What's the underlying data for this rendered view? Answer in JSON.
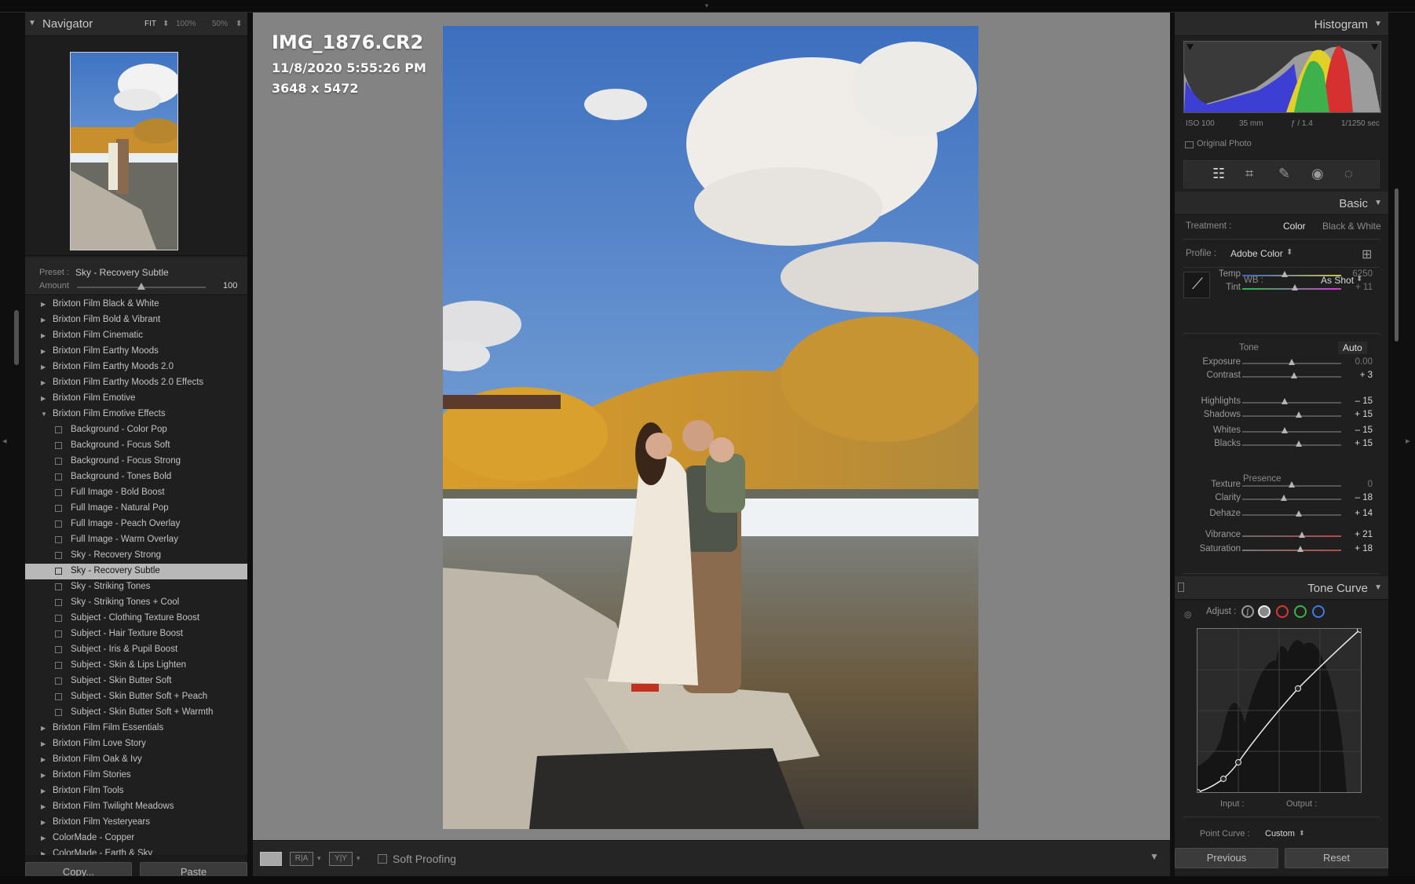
{
  "navigator": {
    "title": "Navigator",
    "zoom_options": [
      "FIT",
      "100%",
      "50%"
    ]
  },
  "preset": {
    "label": "Preset :",
    "value": "Sky - Recovery Subtle",
    "amount_label": "Amount",
    "amount_value": "100",
    "amount_fraction": 0.5
  },
  "preset_list": [
    {
      "label": "Brixton Film Black & White",
      "type": "group",
      "open": false
    },
    {
      "label": "Brixton Film Bold & Vibrant",
      "type": "group",
      "open": false
    },
    {
      "label": "Brixton Film Cinematic",
      "type": "group",
      "open": false
    },
    {
      "label": "Brixton Film Earthy Moods",
      "type": "group",
      "open": false
    },
    {
      "label": "Brixton Film Earthy Moods 2.0",
      "type": "group",
      "open": false
    },
    {
      "label": "Brixton Film Earthy Moods 2.0 Effects",
      "type": "group",
      "open": false
    },
    {
      "label": "Brixton Film Emotive",
      "type": "group",
      "open": false
    },
    {
      "label": "Brixton Film Emotive Effects",
      "type": "group",
      "open": true
    },
    {
      "label": "Background - Color Pop",
      "type": "preset"
    },
    {
      "label": "Background - Focus Soft",
      "type": "preset"
    },
    {
      "label": "Background - Focus Strong",
      "type": "preset"
    },
    {
      "label": "Background - Tones Bold",
      "type": "preset"
    },
    {
      "label": "Full Image - Bold Boost",
      "type": "preset"
    },
    {
      "label": "Full Image - Natural Pop",
      "type": "preset"
    },
    {
      "label": "Full Image - Peach Overlay",
      "type": "preset"
    },
    {
      "label": "Full Image - Warm Overlay",
      "type": "preset"
    },
    {
      "label": "Sky - Recovery Strong",
      "type": "preset"
    },
    {
      "label": "Sky - Recovery Subtle",
      "type": "preset",
      "selected": true
    },
    {
      "label": "Sky - Striking Tones",
      "type": "preset"
    },
    {
      "label": "Sky - Striking Tones + Cool",
      "type": "preset"
    },
    {
      "label": "Subject - Clothing Texture Boost",
      "type": "preset"
    },
    {
      "label": "Subject - Hair Texture Boost",
      "type": "preset"
    },
    {
      "label": "Subject - Iris & Pupil Boost",
      "type": "preset"
    },
    {
      "label": "Subject - Skin & Lips Lighten",
      "type": "preset"
    },
    {
      "label": "Subject - Skin Butter Soft",
      "type": "preset"
    },
    {
      "label": "Subject - Skin Butter Soft + Peach",
      "type": "preset"
    },
    {
      "label": "Subject - Skin Butter Soft + Warmth",
      "type": "preset"
    },
    {
      "label": "Brixton Film Film Essentials",
      "type": "group",
      "open": false
    },
    {
      "label": "Brixton Film Love Story",
      "type": "group",
      "open": false
    },
    {
      "label": "Brixton Film Oak & Ivy",
      "type": "group",
      "open": false
    },
    {
      "label": "Brixton Film Stories",
      "type": "group",
      "open": false
    },
    {
      "label": "Brixton Film Tools",
      "type": "group",
      "open": false
    },
    {
      "label": "Brixton Film Twilight Meadows",
      "type": "group",
      "open": false
    },
    {
      "label": "Brixton Film Yesteryears",
      "type": "group",
      "open": false
    },
    {
      "label": "ColorMade - Copper",
      "type": "group",
      "open": false
    },
    {
      "label": "ColorMade - Earth & Sky",
      "type": "group",
      "open": false
    }
  ],
  "left_buttons": {
    "copy": "Copy...",
    "paste": "Paste"
  },
  "image_info": {
    "filename": "IMG_1876.CR2",
    "datetime": "11/8/2020 5:55:26 PM",
    "dimensions": "3648 x 5472"
  },
  "toolbar": {
    "soft_proofing": "Soft Proofing"
  },
  "histogram": {
    "title": "Histogram",
    "iso": "ISO 100",
    "focal": "35 mm",
    "aperture": "ƒ / 1.4",
    "shutter": "1/1250 sec",
    "original_photo": "Original Photo"
  },
  "tools": [
    "sliders-icon",
    "crop-icon",
    "healing-icon",
    "redeye-icon",
    "mask-icon"
  ],
  "basic": {
    "title": "Basic",
    "treatment_label": "Treatment :",
    "treatment_color": "Color",
    "treatment_bw": "Black & White",
    "profile_label": "Profile :",
    "profile_value": "Adobe Color",
    "wb_label": "WB :",
    "wb_value": "As Shot",
    "tone_label": "Tone",
    "auto_label": "Auto",
    "presence_label": "Presence"
  },
  "sliders": {
    "temp": {
      "label": "Temp",
      "value": "6250",
      "pos": 0.43,
      "dim": true
    },
    "tint": {
      "label": "Tint",
      "value": "+ 11",
      "pos": 0.53,
      "dim": true
    },
    "exposure": {
      "label": "Exposure",
      "value": "0.00",
      "pos": 0.5,
      "dim": true
    },
    "contrast": {
      "label": "Contrast",
      "value": "+ 3",
      "pos": 0.52
    },
    "highlights": {
      "label": "Highlights",
      "value": "– 15",
      "pos": 0.43
    },
    "shadows": {
      "label": "Shadows",
      "value": "+ 15",
      "pos": 0.57
    },
    "whites": {
      "label": "Whites",
      "value": "– 15",
      "pos": 0.43
    },
    "blacks": {
      "label": "Blacks",
      "value": "+ 15",
      "pos": 0.57
    },
    "texture": {
      "label": "Texture",
      "value": "0",
      "pos": 0.5,
      "dim": true
    },
    "clarity": {
      "label": "Clarity",
      "value": "– 18",
      "pos": 0.42
    },
    "dehaze": {
      "label": "Dehaze",
      "value": "+ 14",
      "pos": 0.57
    },
    "vibrance": {
      "label": "Vibrance",
      "value": "+ 21",
      "pos": 0.6
    },
    "saturation": {
      "label": "Saturation",
      "value": "+ 18",
      "pos": 0.59
    }
  },
  "tone_curve": {
    "title": "Tone Curve",
    "adjust_label": "Adjust :",
    "input_label": "Input :",
    "output_label": "Output :",
    "point_curve_label": "Point Curve :",
    "point_curve_value": "Custom"
  },
  "right_buttons": {
    "previous": "Previous",
    "reset": "Reset"
  }
}
